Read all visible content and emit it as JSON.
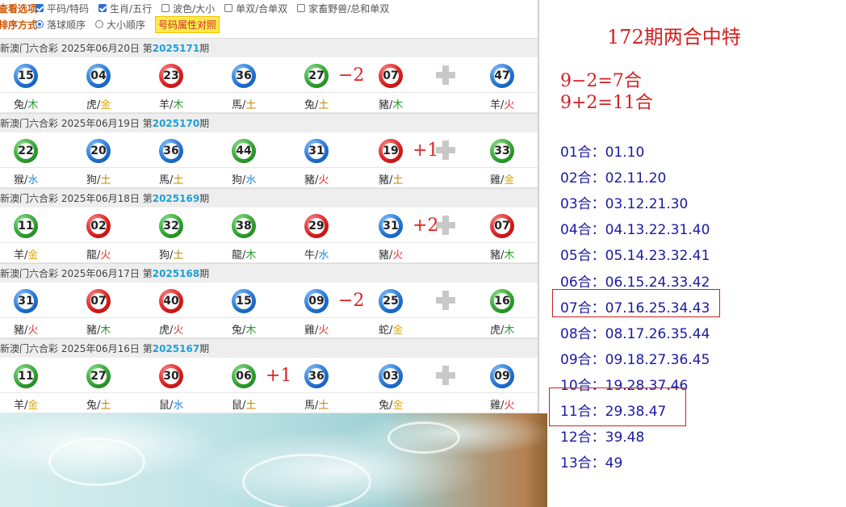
{
  "options": {
    "label1": "查看选项:",
    "label2": "排序方式:",
    "checks": [
      {
        "label": "平码/特码",
        "checked": true
      },
      {
        "label": "生肖/五行",
        "checked": true
      },
      {
        "label": "波色/大小",
        "checked": false
      },
      {
        "label": "单双/合单双",
        "checked": false
      },
      {
        "label": "家畜野兽/总和单双",
        "checked": false
      }
    ],
    "radios": [
      {
        "label": "落球顺序",
        "checked": true
      },
      {
        "label": "大小顺序",
        "checked": false
      }
    ],
    "button": "号码属性对照"
  },
  "draws": [
    {
      "prefix": "新澳门六合彩 2025年06月20日 第",
      "issue": "2025171",
      "suffix": "期",
      "balls": [
        [
          "15",
          "blue"
        ],
        [
          "04",
          "blue"
        ],
        [
          "23",
          "red"
        ],
        [
          "36",
          "blue"
        ],
        [
          "27",
          "green"
        ],
        [
          "07",
          "red"
        ],
        [
          "47",
          "blue"
        ]
      ],
      "delta": {
        "after": 4,
        "text": "−2"
      },
      "zod": [
        [
          "兔",
          "木",
          "mu"
        ],
        [
          "虎",
          "金",
          "jin"
        ],
        [
          "羊",
          "木",
          "mu"
        ],
        [
          "馬",
          "土",
          "tu"
        ],
        [
          "兔",
          "土",
          "tu"
        ],
        [
          "豬",
          "木",
          "mu"
        ],
        [
          "羊",
          "火",
          "huo"
        ]
      ]
    },
    {
      "prefix": "新澳门六合彩 2025年06月19日 第",
      "issue": "2025170",
      "suffix": "期",
      "balls": [
        [
          "22",
          "green"
        ],
        [
          "20",
          "blue"
        ],
        [
          "36",
          "blue"
        ],
        [
          "44",
          "green"
        ],
        [
          "31",
          "blue"
        ],
        [
          "19",
          "red"
        ],
        [
          "33",
          "green"
        ]
      ],
      "delta": {
        "after": 5,
        "text": "+1"
      },
      "zod": [
        [
          "猴",
          "水",
          "shui"
        ],
        [
          "狗",
          "土",
          "tu"
        ],
        [
          "馬",
          "土",
          "tu"
        ],
        [
          "狗",
          "水",
          "shui"
        ],
        [
          "豬",
          "火",
          "huo"
        ],
        [
          "豬",
          "土",
          "tu"
        ],
        [
          "雞",
          "金",
          "jin"
        ]
      ]
    },
    {
      "prefix": "新澳门六合彩 2025年06月18日 第",
      "issue": "2025169",
      "suffix": "期",
      "balls": [
        [
          "11",
          "green"
        ],
        [
          "02",
          "red"
        ],
        [
          "32",
          "green"
        ],
        [
          "38",
          "green"
        ],
        [
          "29",
          "red"
        ],
        [
          "31",
          "blue"
        ],
        [
          "07",
          "red"
        ]
      ],
      "delta": {
        "after": 5,
        "text": "+2"
      },
      "zod": [
        [
          "羊",
          "金",
          "jin"
        ],
        [
          "龍",
          "火",
          "huo"
        ],
        [
          "狗",
          "土",
          "tu"
        ],
        [
          "龍",
          "木",
          "mu"
        ],
        [
          "牛",
          "水",
          "shui"
        ],
        [
          "豬",
          "火",
          "huo"
        ],
        [
          "豬",
          "木",
          "mu"
        ]
      ]
    },
    {
      "prefix": "新澳门六合彩 2025年06月17日 第",
      "issue": "2025168",
      "suffix": "期",
      "balls": [
        [
          "31",
          "blue"
        ],
        [
          "07",
          "red"
        ],
        [
          "40",
          "red"
        ],
        [
          "15",
          "blue"
        ],
        [
          "09",
          "blue"
        ],
        [
          "25",
          "blue"
        ],
        [
          "16",
          "green"
        ]
      ],
      "delta": {
        "after": 4,
        "text": "−2"
      },
      "zod": [
        [
          "豬",
          "火",
          "huo"
        ],
        [
          "豬",
          "木",
          "mu"
        ],
        [
          "虎",
          "火",
          "huo"
        ],
        [
          "兔",
          "木",
          "mu"
        ],
        [
          "雞",
          "火",
          "huo"
        ],
        [
          "蛇",
          "金",
          "jin"
        ],
        [
          "虎",
          "木",
          "mu"
        ]
      ]
    },
    {
      "prefix": "新澳门六合彩 2025年06月16日 第",
      "issue": "2025167",
      "suffix": "期",
      "balls": [
        [
          "11",
          "green"
        ],
        [
          "27",
          "green"
        ],
        [
          "30",
          "red"
        ],
        [
          "06",
          "green"
        ],
        [
          "36",
          "blue"
        ],
        [
          "03",
          "blue"
        ],
        [
          "09",
          "blue"
        ]
      ],
      "delta": {
        "after": 3,
        "text": "+1"
      },
      "zod": [
        [
          "羊",
          "金",
          "jin"
        ],
        [
          "兔",
          "土",
          "tu"
        ],
        [
          "鼠",
          "水",
          "shui"
        ],
        [
          "鼠",
          "土",
          "tu"
        ],
        [
          "馬",
          "土",
          "tu"
        ],
        [
          "兔",
          "金",
          "jin"
        ],
        [
          "雞",
          "火",
          "huo"
        ]
      ]
    }
  ],
  "right": {
    "title": "172期两合中特",
    "eq1": "9−2=7合",
    "eq2": "9+2=11合",
    "he": [
      "01合：01.10",
      "02合：02.11.20",
      "03合：03.12.21.30",
      "04合：04.13.22.31.40",
      "05合：05.14.23.32.41",
      "06合：06.15.24.33.42",
      "07合：07.16.25.34.43",
      "08合：08.17.26.35.44",
      "09合：09.18.27.36.45",
      "10合：19.28.37.46",
      "11合：29.38.47",
      "12合：39.48",
      "13合：49"
    ],
    "highlighted": [
      6,
      10
    ]
  }
}
